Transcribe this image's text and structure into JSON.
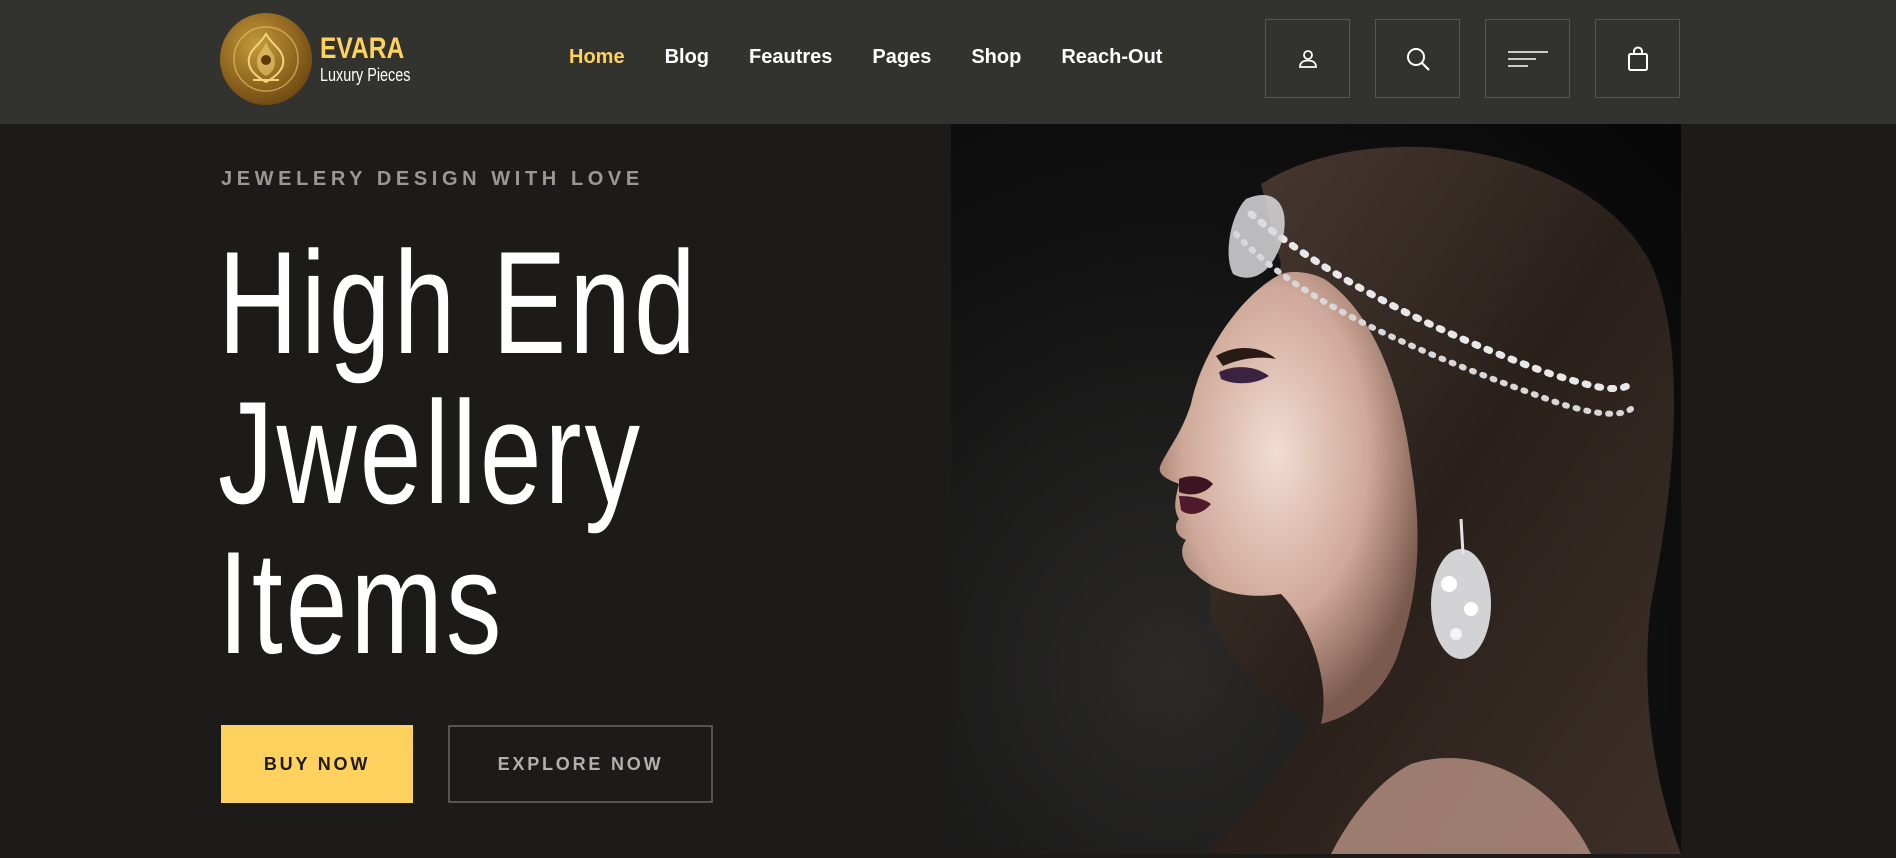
{
  "brand": {
    "name": "EVARA",
    "tagline": "Luxury Pieces"
  },
  "nav": {
    "items": [
      {
        "label": "Home",
        "active": true
      },
      {
        "label": "Blog"
      },
      {
        "label": "Feautres"
      },
      {
        "label": "Pages"
      },
      {
        "label": "Shop"
      },
      {
        "label": "Reach-Out"
      }
    ]
  },
  "header_icons": [
    "user-icon",
    "search-icon",
    "menu-icon",
    "shopping-bag-icon"
  ],
  "hero": {
    "subtitle": "JEWELERY DESIGN WITH LOVE",
    "headline": [
      "High End",
      "Jwellery",
      "Items"
    ],
    "buy_label": "BUY NOW",
    "explore_label": "EXPLORE NOW"
  },
  "colors": {
    "accent": "#ffd15e",
    "header_bg": "#32322e",
    "page_bg": "#1c1b1a"
  }
}
